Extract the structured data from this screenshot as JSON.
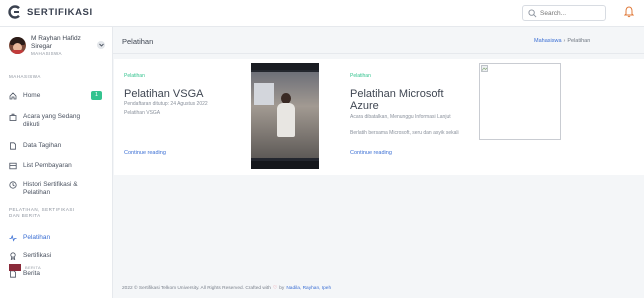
{
  "app": {
    "name": "SERTIFIKASI",
    "search_placeholder": "Search..."
  },
  "profile": {
    "name": "M Rayhan Hafidz Siregar",
    "role": "MAHASISWA"
  },
  "sidebar": {
    "section_mahasiswa": "MAHASISWA",
    "items": [
      {
        "label": "Home",
        "icon": "home-icon",
        "badge": "1"
      },
      {
        "label": "Acara yang Sedang diikuti",
        "icon": "bag-icon"
      },
      {
        "label": "Data Tagihan",
        "icon": "document-icon"
      },
      {
        "label": "List Pembayaran",
        "icon": "list-icon"
      },
      {
        "label": "Histori Sertifikasi & Pelatihan",
        "icon": "clock-icon"
      }
    ],
    "section_pelatihan": "PELATIHAN, SERTIFIKASI DAN BERITA",
    "items2": [
      {
        "label": "Pelatihan",
        "icon": "pulse-icon",
        "active": true
      },
      {
        "label": "Sertifikasi",
        "icon": "award-icon"
      },
      {
        "label": "Berita",
        "icon": "document-icon"
      }
    ],
    "bottom_label": "BERITA"
  },
  "page": {
    "title": "Pelatihan",
    "breadcrumb_parent": "Mahasiswa",
    "breadcrumb_sep": "›",
    "breadcrumb_current": "Pelatihan"
  },
  "cards": [
    {
      "tag": "Pelatihan",
      "title": "Pelatihan VSGA",
      "subtitle": "Pendaftaran ditutup: 24 Agustus 2022",
      "desc": "Pelatihan VSGA",
      "link": "Continue reading"
    },
    {
      "tag": "Pelatihan",
      "title": "Pelatihan Microsoft Azure",
      "subtitle": "Acara dibatalkan, Menunggu Informasi Lanjut",
      "desc": "Berlatih bersama Microsoft, seru dan asyik sekali",
      "link": "Continue reading"
    }
  ],
  "footer": {
    "prefix": "2022 © Sertifikasi Telkom University. All Rights Reserved. Crafted with",
    "heart": "♡",
    "by": "by",
    "authors": "Nadila, Rayhan, Ipeh"
  },
  "colors": {
    "accent": "#3b6fd4",
    "success": "#34c38f",
    "danger": "#e85a6f"
  }
}
